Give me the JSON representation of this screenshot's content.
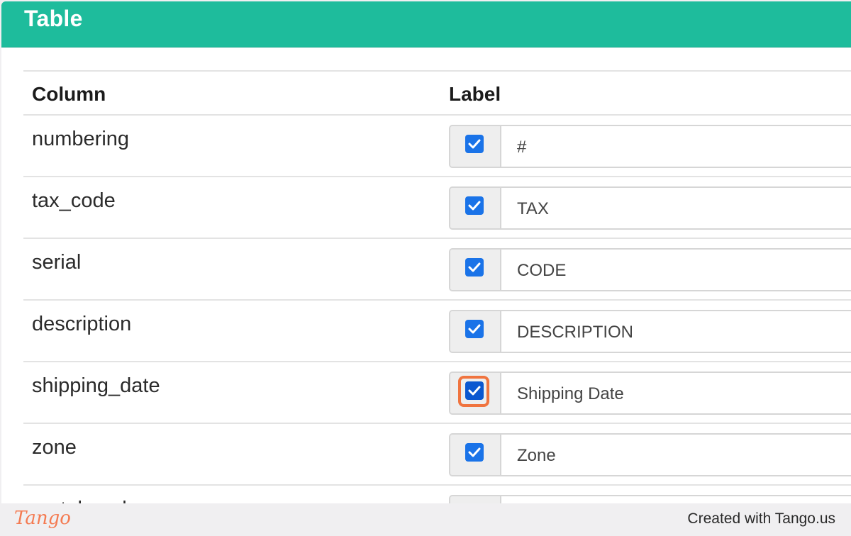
{
  "panel": {
    "title": "Table"
  },
  "table": {
    "headers": {
      "column": "Column",
      "label": "Label"
    },
    "rows": [
      {
        "column": "numbering",
        "label": "#",
        "checked": true
      },
      {
        "column": "tax_code",
        "label": "TAX",
        "checked": true
      },
      {
        "column": "serial",
        "label": "CODE",
        "checked": true
      },
      {
        "column": "description",
        "label": "DESCRIPTION",
        "checked": true
      },
      {
        "column": "shipping_date",
        "label": "Shipping Date",
        "checked": true,
        "highlighted": true
      },
      {
        "column": "zone",
        "label": "Zone",
        "checked": true
      },
      {
        "column": "metal_code",
        "label": "",
        "checked": true
      }
    ]
  },
  "footer": {
    "brand": "Tango",
    "credit": "Created with Tango.us"
  },
  "colors": {
    "header": "#1ebc9c",
    "checkbox": "#1a73e8",
    "highlight": "#f0743f"
  }
}
